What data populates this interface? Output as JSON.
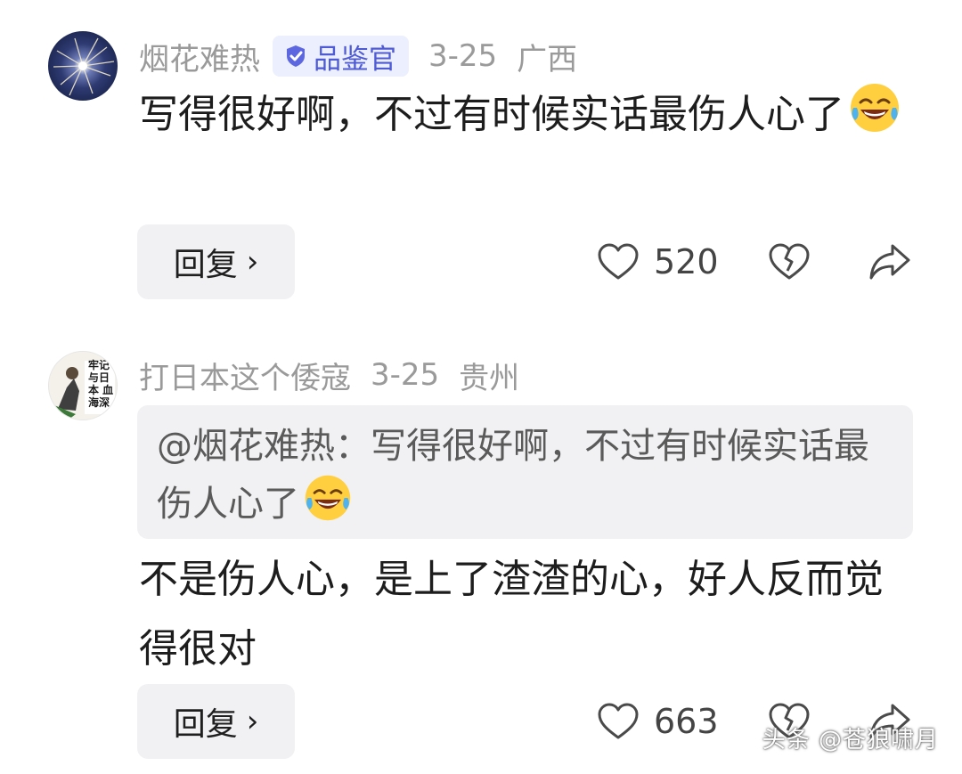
{
  "comments": [
    {
      "username": "烟花难热",
      "badge": "品鉴官",
      "date": "3-25",
      "location": "广西",
      "text": "写得很好啊，不过有时候实话最伤人心了",
      "reply_label": "回复",
      "likes": "520"
    },
    {
      "username": "打日本这个倭寇",
      "date": "3-25",
      "location": "贵州",
      "quote": "@烟花难热：写得很好啊，不过有时候实话最伤人心了",
      "text": "不是伤人心，是上了渣渣的心，好人反而觉得很对",
      "avatar_text": "牢记 与日本 血海深",
      "reply_label": "回复",
      "likes": "663"
    }
  ],
  "watermark": "头条 @苍狼啸月",
  "icons": {
    "badge": "check-shield-icon",
    "like": "heart-outline-icon",
    "dislike": "broken-heart-icon",
    "share": "share-arrow-icon",
    "emoji": "laughing-tears-emoji"
  },
  "colors": {
    "badge_bg": "#eceffd",
    "badge_text": "#4f5bd5",
    "meta_text": "#9a9a9a",
    "quote_bg": "#f1f1f3"
  }
}
